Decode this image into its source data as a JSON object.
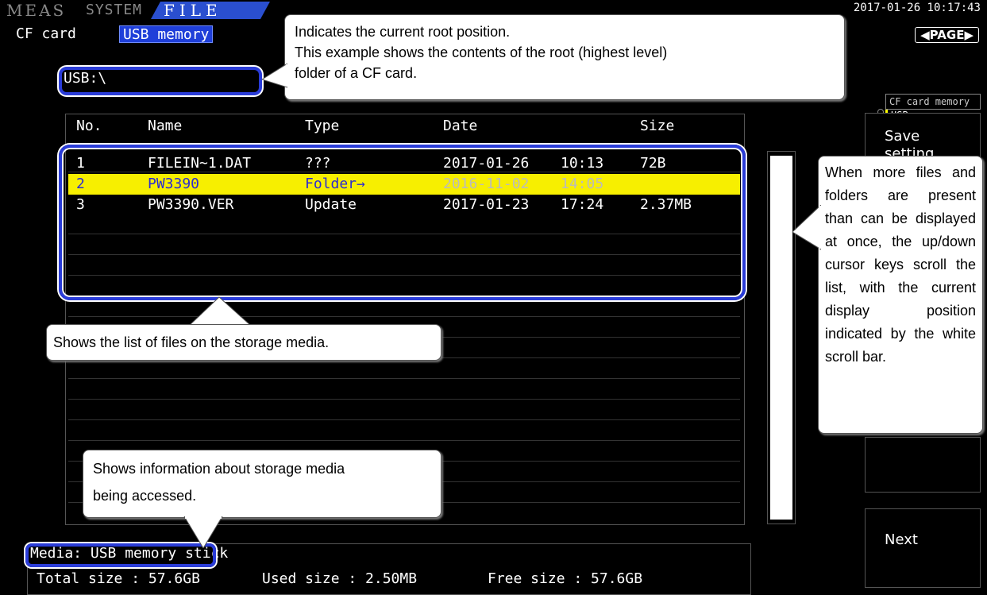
{
  "mode_tabs": [
    "MEAS",
    "SYSTEM",
    "FILE"
  ],
  "media_tabs": [
    "CF card",
    "USB memory"
  ],
  "clock": "2017-01-26 10:17:43",
  "page_key": "PAGE",
  "path": "USB:\\",
  "media_select": [
    "CF card memory",
    "USB   memory"
  ],
  "columns": [
    "No.",
    "Name",
    "Type",
    "Date",
    "Size"
  ],
  "files": [
    {
      "no": "1",
      "name": "FILEIN~1.DAT",
      "type": "???",
      "date": "2017-01-26",
      "time": "10:13",
      "size": "72B"
    },
    {
      "no": "2",
      "name": "PW3390",
      "type": "Folder→",
      "date": "2016-11-02",
      "time": "14:05",
      "size": ""
    },
    {
      "no": "3",
      "name": "PW3390.VER",
      "type": "Update",
      "date": "2017-01-23",
      "time": "17:24",
      "size": "2.37MB"
    }
  ],
  "function_keys": [
    "Save setting",
    "",
    "",
    "Next"
  ],
  "media_info": "Media: USB memory stick",
  "sizes": {
    "total": "Total size : 57.6GB",
    "used": "Used size : 2.50MB",
    "free": "Free size : 57.6GB"
  },
  "callouts": {
    "root": [
      "Indicates the current root position.",
      "This example shows the contents of the root (highest level)",
      "folder of a CF card."
    ],
    "list": "Shows the list of files on the storage media.",
    "media": [
      "Shows information about storage media",
      "being accessed."
    ],
    "scroll": "When more files and folders are present than can be displayed at once, the up/down cursor keys scroll the list, with the current display position indicated by the white scroll bar."
  }
}
